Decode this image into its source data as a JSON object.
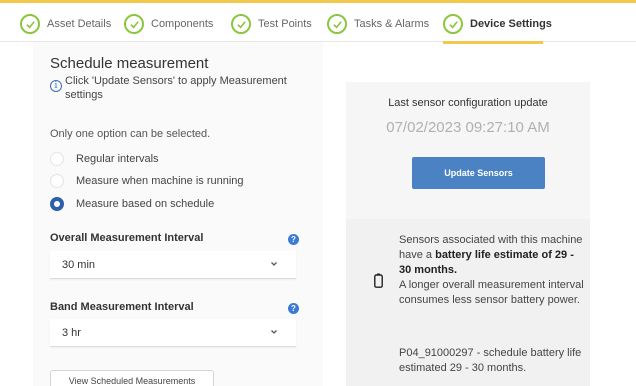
{
  "tabs": [
    {
      "label": "Asset Details",
      "icon": "check-circle-icon"
    },
    {
      "label": "Components",
      "icon": "check-circle-icon"
    },
    {
      "label": "Test Points",
      "icon": "check-circle-icon"
    },
    {
      "label": "Tasks & Alarms",
      "icon": "check-circle-icon"
    },
    {
      "label": "Device Settings",
      "icon": "check-circle-icon"
    }
  ],
  "active_tab": "Device Settings",
  "colors": {
    "accent": "#f2c94c",
    "check": "#8cc63f",
    "primary": "#4b82c4",
    "radio": "#2f5fa8"
  },
  "schedule": {
    "title": "Schedule measurement",
    "info": "Click 'Update Sensors' to apply Measurement settings",
    "only_one": "Only one option can be selected.",
    "options": [
      "Regular intervals",
      "Measure when machine is running",
      "Measure based on schedule"
    ],
    "selected_option": "Measure based on schedule",
    "overall_label": "Overall Measurement Interval",
    "overall_value": "30 min",
    "band_label": "Band Measurement Interval",
    "band_value": "3 hr",
    "view_button": "View Scheduled Measurements"
  },
  "sensor_panel": {
    "last_update_title": "Last sensor configuration update",
    "last_update_date": "07/02/2023 09:27:10 AM",
    "update_button": "Update Sensors",
    "battery_pre": "Sensors associated with this machine have a ",
    "battery_bold": "battery life estimate of 29 - 30 months.",
    "battery_post": "A longer overall measurement interval consumes less sensor battery power.",
    "sensor_line": "P04_91000297 - schedule battery life estimated 29 - 30 months."
  }
}
